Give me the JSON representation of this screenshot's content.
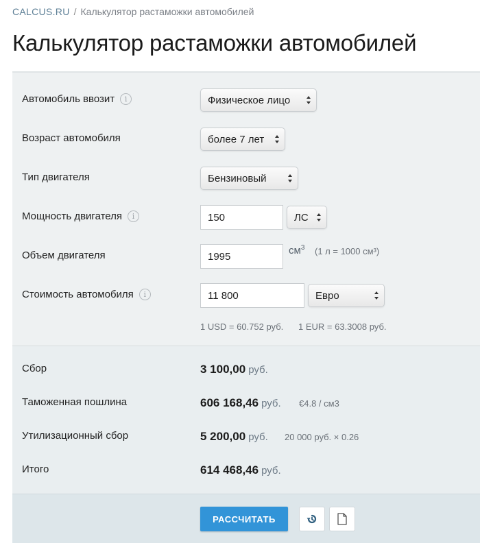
{
  "breadcrumb": {
    "site": "CALCUS.RU",
    "separator": "/",
    "page": "Калькулятор растаможки автомобилей"
  },
  "title": "Калькулятор растаможки автомобилей",
  "form": {
    "importer": {
      "label": "Автомобиль ввозит",
      "value": "Физическое лицо"
    },
    "age": {
      "label": "Возраст автомобиля",
      "value": "более 7 лет"
    },
    "engine_type": {
      "label": "Тип двигателя",
      "value": "Бензиновый"
    },
    "power": {
      "label": "Мощность двигателя",
      "value": "150",
      "unit": "ЛС"
    },
    "volume": {
      "label": "Объем двигателя",
      "value": "1995",
      "unit": "см",
      "unit_sup": "3",
      "hint": "(1 л = 1000 см³)"
    },
    "cost": {
      "label": "Стоимость автомобиля",
      "value": "11 800",
      "currency": "Евро"
    },
    "rates": {
      "usd": "1 USD = 60.752 руб.",
      "eur": "1 EUR = 63.3008 руб."
    }
  },
  "results": {
    "fee": {
      "label": "Сбор",
      "value": "3 100,00",
      "currency": "руб."
    },
    "duty": {
      "label": "Таможенная пошлина",
      "value": "606 168,46",
      "currency": "руб.",
      "note": "€4.8 / см3"
    },
    "recycling": {
      "label": "Утилизационный сбор",
      "value": "5 200,00",
      "currency": "руб.",
      "note": "20 000 руб. × 0.26"
    },
    "total": {
      "label": "Итого",
      "value": "614 468,46",
      "currency": "руб."
    }
  },
  "actions": {
    "calculate": "РАССЧИТАТЬ",
    "reset_icon": "history-icon",
    "document_icon": "document-icon"
  },
  "colors": {
    "primary_button": "#3294d8",
    "form_bg": "#eef1f2",
    "result_bg": "#e9eef0"
  }
}
